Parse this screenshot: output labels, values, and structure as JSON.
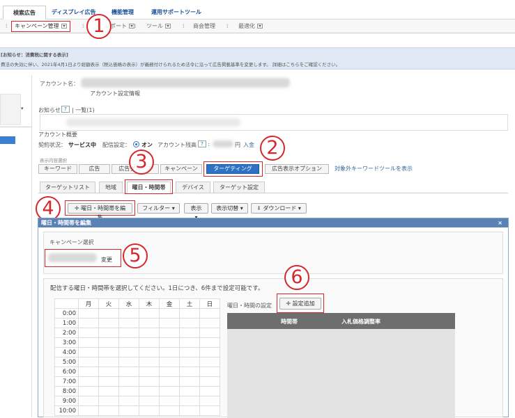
{
  "top_tabs": [
    "検索広告",
    "ディスプレイ広告",
    "機能管理",
    "運用サポートツール"
  ],
  "subnav": {
    "campaign_mgmt": "キャンペーン管理",
    "report": "レポート",
    "tools": "ツール",
    "business_mgmt": "商会管理",
    "optimization": "最適化"
  },
  "notice": {
    "title": "お知らせ：消費税に関する表示",
    "body": "費法の失効に伴い、2021年4月1日より総額表示（税込価格の表示）が義務付けられるため法令に沿って広告掲載基準を変更します。 詳細はこちらをご確認ください。"
  },
  "account": {
    "name_label": "アカウント名：",
    "settings_link": "アカウント設定情報",
    "news_label": "お知らせ",
    "news_list": "一覧(1)",
    "overview_label": "アカウント概要",
    "contract_label": "契約状況：",
    "contract_value": "サービス中",
    "delivery_label": "配信設定：",
    "delivery_value": "オン",
    "balance_label": "アカウント残高",
    "balance_unit": "円",
    "deposit": "入金"
  },
  "view_switch": {
    "label": "表示内容選択",
    "buttons": [
      "キーワード",
      "広告",
      "広告グループ",
      "キャンペーン",
      "ターゲティング",
      "広告表示オプション"
    ],
    "link": "対象外キーワードツールを表示"
  },
  "target_tabs": [
    "ターゲットリスト",
    "地域",
    "曜日・時間帯",
    "デバイス",
    "ターゲット設定"
  ],
  "toolbar": {
    "edit": "曜日・時間帯を編集",
    "filter": "フィルター",
    "display": "表示",
    "view_switch": "表示切替",
    "download": "ダウンロード"
  },
  "modal": {
    "title": "曜日・時間帯を編集",
    "close": "×",
    "campaign_select_label": "キャンペーン選択",
    "change": "変更",
    "instructions": "配信する曜日・時間帯を選択してください。1日につき、6件まで設定可能です。",
    "days": [
      "月",
      "火",
      "水",
      "木",
      "金",
      "土",
      "日"
    ],
    "times": [
      "0:00",
      "1:00",
      "2:00",
      "3:00",
      "4:00",
      "5:00",
      "6:00",
      "7:00",
      "8:00",
      "9:00",
      "10:00"
    ],
    "setting_label": "曜日・時間の設定",
    "add_setting": "設定追加",
    "col_time": "時間帯",
    "col_bid": "入札価格調整率"
  },
  "markers": [
    "1",
    "2",
    "3",
    "4",
    "5",
    "6"
  ],
  "colors": {
    "accent": "#2e72c4",
    "annotation": "#d6262b",
    "modal_header": "#5b82b5"
  }
}
